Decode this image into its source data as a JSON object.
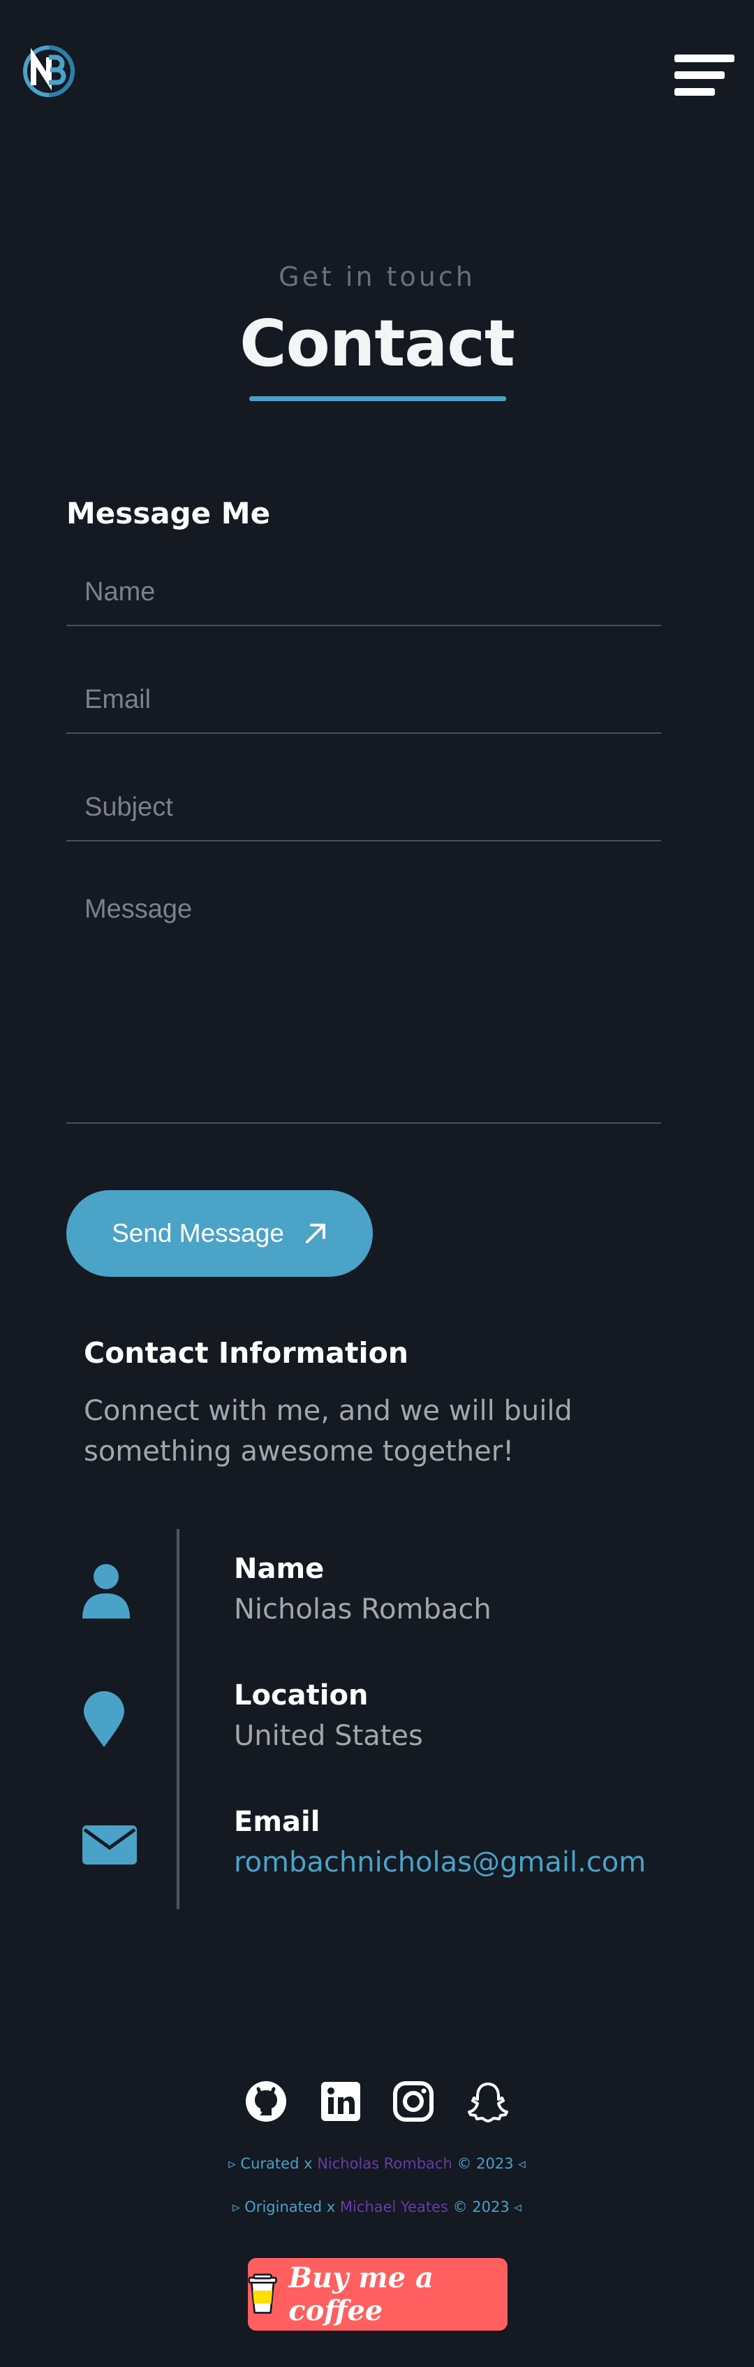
{
  "header": {
    "logo_text": "NB",
    "menu_icon": "hamburger-icon"
  },
  "hero": {
    "subtitle": "Get in touch",
    "title": "Contact"
  },
  "form": {
    "heading": "Message Me",
    "name_placeholder": "Name",
    "email_placeholder": "Email",
    "subject_placeholder": "Subject",
    "message_placeholder": "Message",
    "send_label": "Send Message",
    "send_icon": "arrow-up-right-icon"
  },
  "contact_info": {
    "heading": "Contact Information",
    "description": "Connect with me, and we will build something awesome together!",
    "items": [
      {
        "label": "Name",
        "value": "Nicholas Rombach",
        "icon": "user-icon"
      },
      {
        "label": "Location",
        "value": "United States",
        "icon": "map-pin-icon"
      },
      {
        "label": "Email",
        "value": "rombachnicholas@gmail.com",
        "icon": "envelope-icon"
      }
    ]
  },
  "footer": {
    "social": [
      "github-icon",
      "linkedin-icon",
      "instagram-icon",
      "snapchat-icon"
    ],
    "credit1": {
      "prefix": "▹ Curated x ",
      "name": "Nicholas Rombach",
      "suffix": " © 2023 ◃"
    },
    "credit2": {
      "prefix": "▹ Originated x ",
      "name": "Michael Yeates",
      "suffix": " © 2023 ◃"
    },
    "coffee_label": "Buy me a coffee"
  },
  "colors": {
    "background": "#141922",
    "accent": "#4aa2c8",
    "credit_name": "#6a3aa6",
    "coffee_button": "#ff5f5f"
  }
}
